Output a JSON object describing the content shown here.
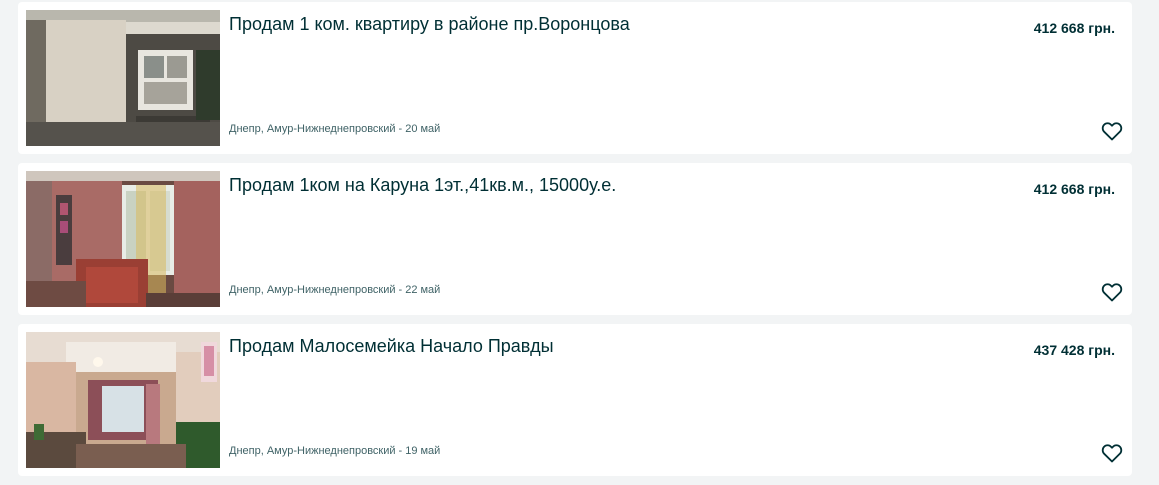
{
  "listings": [
    {
      "title": "Продам 1 ком. квартиру в районе пр.Воронцова",
      "price": "412 668 грн.",
      "location": "Днепр, Амур-Нижнеднепровский",
      "separator": "-",
      "date": "20 май",
      "photo": "house-exterior-photo",
      "favorite_icon": "heart-outline-icon"
    },
    {
      "title": "Продам 1ком на Каруна 1эт.,41кв.м., 15000у.е.",
      "price": "412 668 грн.",
      "location": "Днепр, Амур-Нижнеднепровский",
      "separator": "-",
      "date": "22 май",
      "photo": "living-room-curtains-photo",
      "favorite_icon": "heart-outline-icon"
    },
    {
      "title": "Продам Малосемейка Начало Правды",
      "price": "437 428 грн.",
      "location": "Днепр, Амур-Нижнеднепровский",
      "separator": "-",
      "date": "19 май",
      "photo": "room-interior-photo",
      "favorite_icon": "heart-outline-icon"
    }
  ],
  "colors": {
    "page_background": "#f2f4f5",
    "card_background": "#ffffff",
    "title_text": "#002f34",
    "meta_text": "#406367"
  }
}
